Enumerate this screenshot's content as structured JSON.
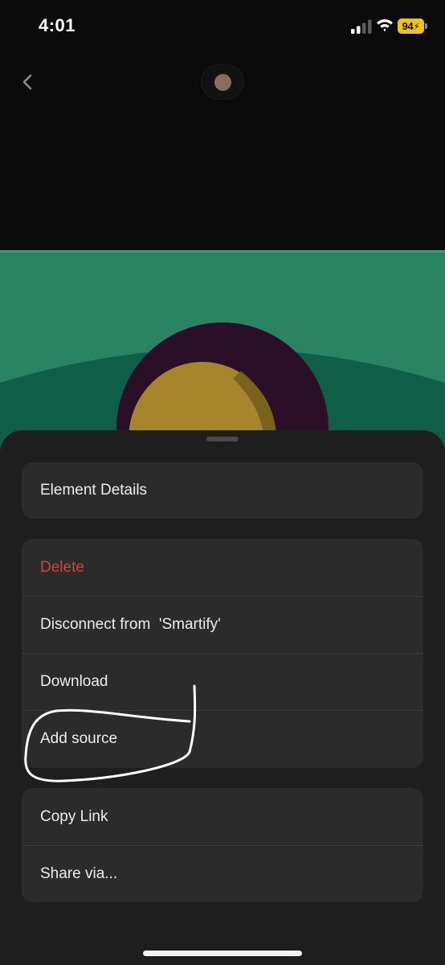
{
  "status_bar": {
    "time": "4:01",
    "battery_percent": "94",
    "icons": [
      "cellular-signal-icon",
      "wifi-icon",
      "battery-charging-icon"
    ]
  },
  "nav": {
    "back_icon": "chevron-left-icon",
    "avatar_color": "#8b6b60"
  },
  "artwork": {
    "colors": {
      "background": "#2a8463",
      "ring": "#2a0f27",
      "disc": "#a6852c"
    }
  },
  "menu": {
    "group1": [
      {
        "label": "Element Details"
      }
    ],
    "group2": [
      {
        "label": "Delete"
      },
      {
        "label": "Disconnect from  'Smartify'"
      },
      {
        "label": "Download"
      },
      {
        "label": "Add source"
      }
    ],
    "group3": [
      {
        "label": "Copy Link"
      },
      {
        "label": "Share via..."
      }
    ]
  },
  "colors": {
    "sheet": "#1e1e1e",
    "row": "#2b2b2b",
    "danger": "#d0443f",
    "battery": "#f1c40f"
  }
}
